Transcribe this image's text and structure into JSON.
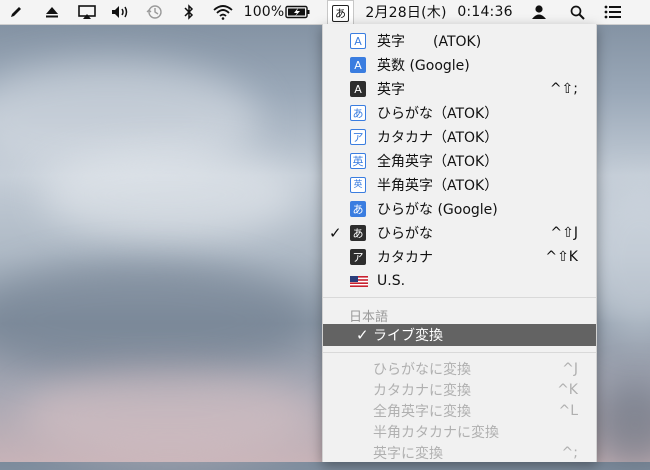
{
  "menubar": {
    "battery_percent": "100%",
    "date": "2月28日(木)",
    "time": "0:14:36",
    "ime_indicator": "あ",
    "icons": [
      "pencil-icon",
      "eject-icon",
      "airplay-icon",
      "volume-icon",
      "time-machine-icon",
      "bluetooth-icon",
      "wifi-icon",
      "battery-charging-icon",
      "user-icon",
      "spotlight-search-icon",
      "notification-center-icon"
    ]
  },
  "menu": {
    "items": [
      {
        "icon": "A",
        "label": "英字　　(ATOK)",
        "shortcut": ""
      },
      {
        "icon": "A",
        "label": "英数 (Google)",
        "shortcut": ""
      },
      {
        "icon": "A",
        "label": "英字",
        "shortcut": "^⇧;"
      },
      {
        "icon": "あ",
        "label": "ひらがな（ATOK）",
        "shortcut": ""
      },
      {
        "icon": "ア",
        "label": "カタカナ（ATOK）",
        "shortcut": ""
      },
      {
        "icon": "英",
        "label": "全角英字（ATOK）",
        "shortcut": ""
      },
      {
        "icon": "英",
        "label": "半角英字（ATOK）",
        "shortcut": ""
      },
      {
        "icon": "あ",
        "label": "ひらがな (Google)",
        "shortcut": ""
      },
      {
        "icon": "あ",
        "label": "ひらがな",
        "shortcut": "^⇧J",
        "checked": "✓"
      },
      {
        "icon": "ア",
        "label": "カタカナ",
        "shortcut": "^⇧K"
      },
      {
        "icon": "us-flag",
        "label": "U.S.",
        "shortcut": ""
      }
    ],
    "section_title": "日本語",
    "selected_item": {
      "check": "✓",
      "label": "ライブ変換"
    },
    "disabled_items": [
      {
        "label": "ひらがなに変換",
        "shortcut": "^J"
      },
      {
        "label": "カタカナに変換",
        "shortcut": "^K"
      },
      {
        "label": "全角英字に変換",
        "shortcut": "^L"
      },
      {
        "label": "半角カタカナに変換",
        "shortcut": ""
      },
      {
        "label": "英字に変換",
        "shortcut": "^;"
      }
    ]
  }
}
